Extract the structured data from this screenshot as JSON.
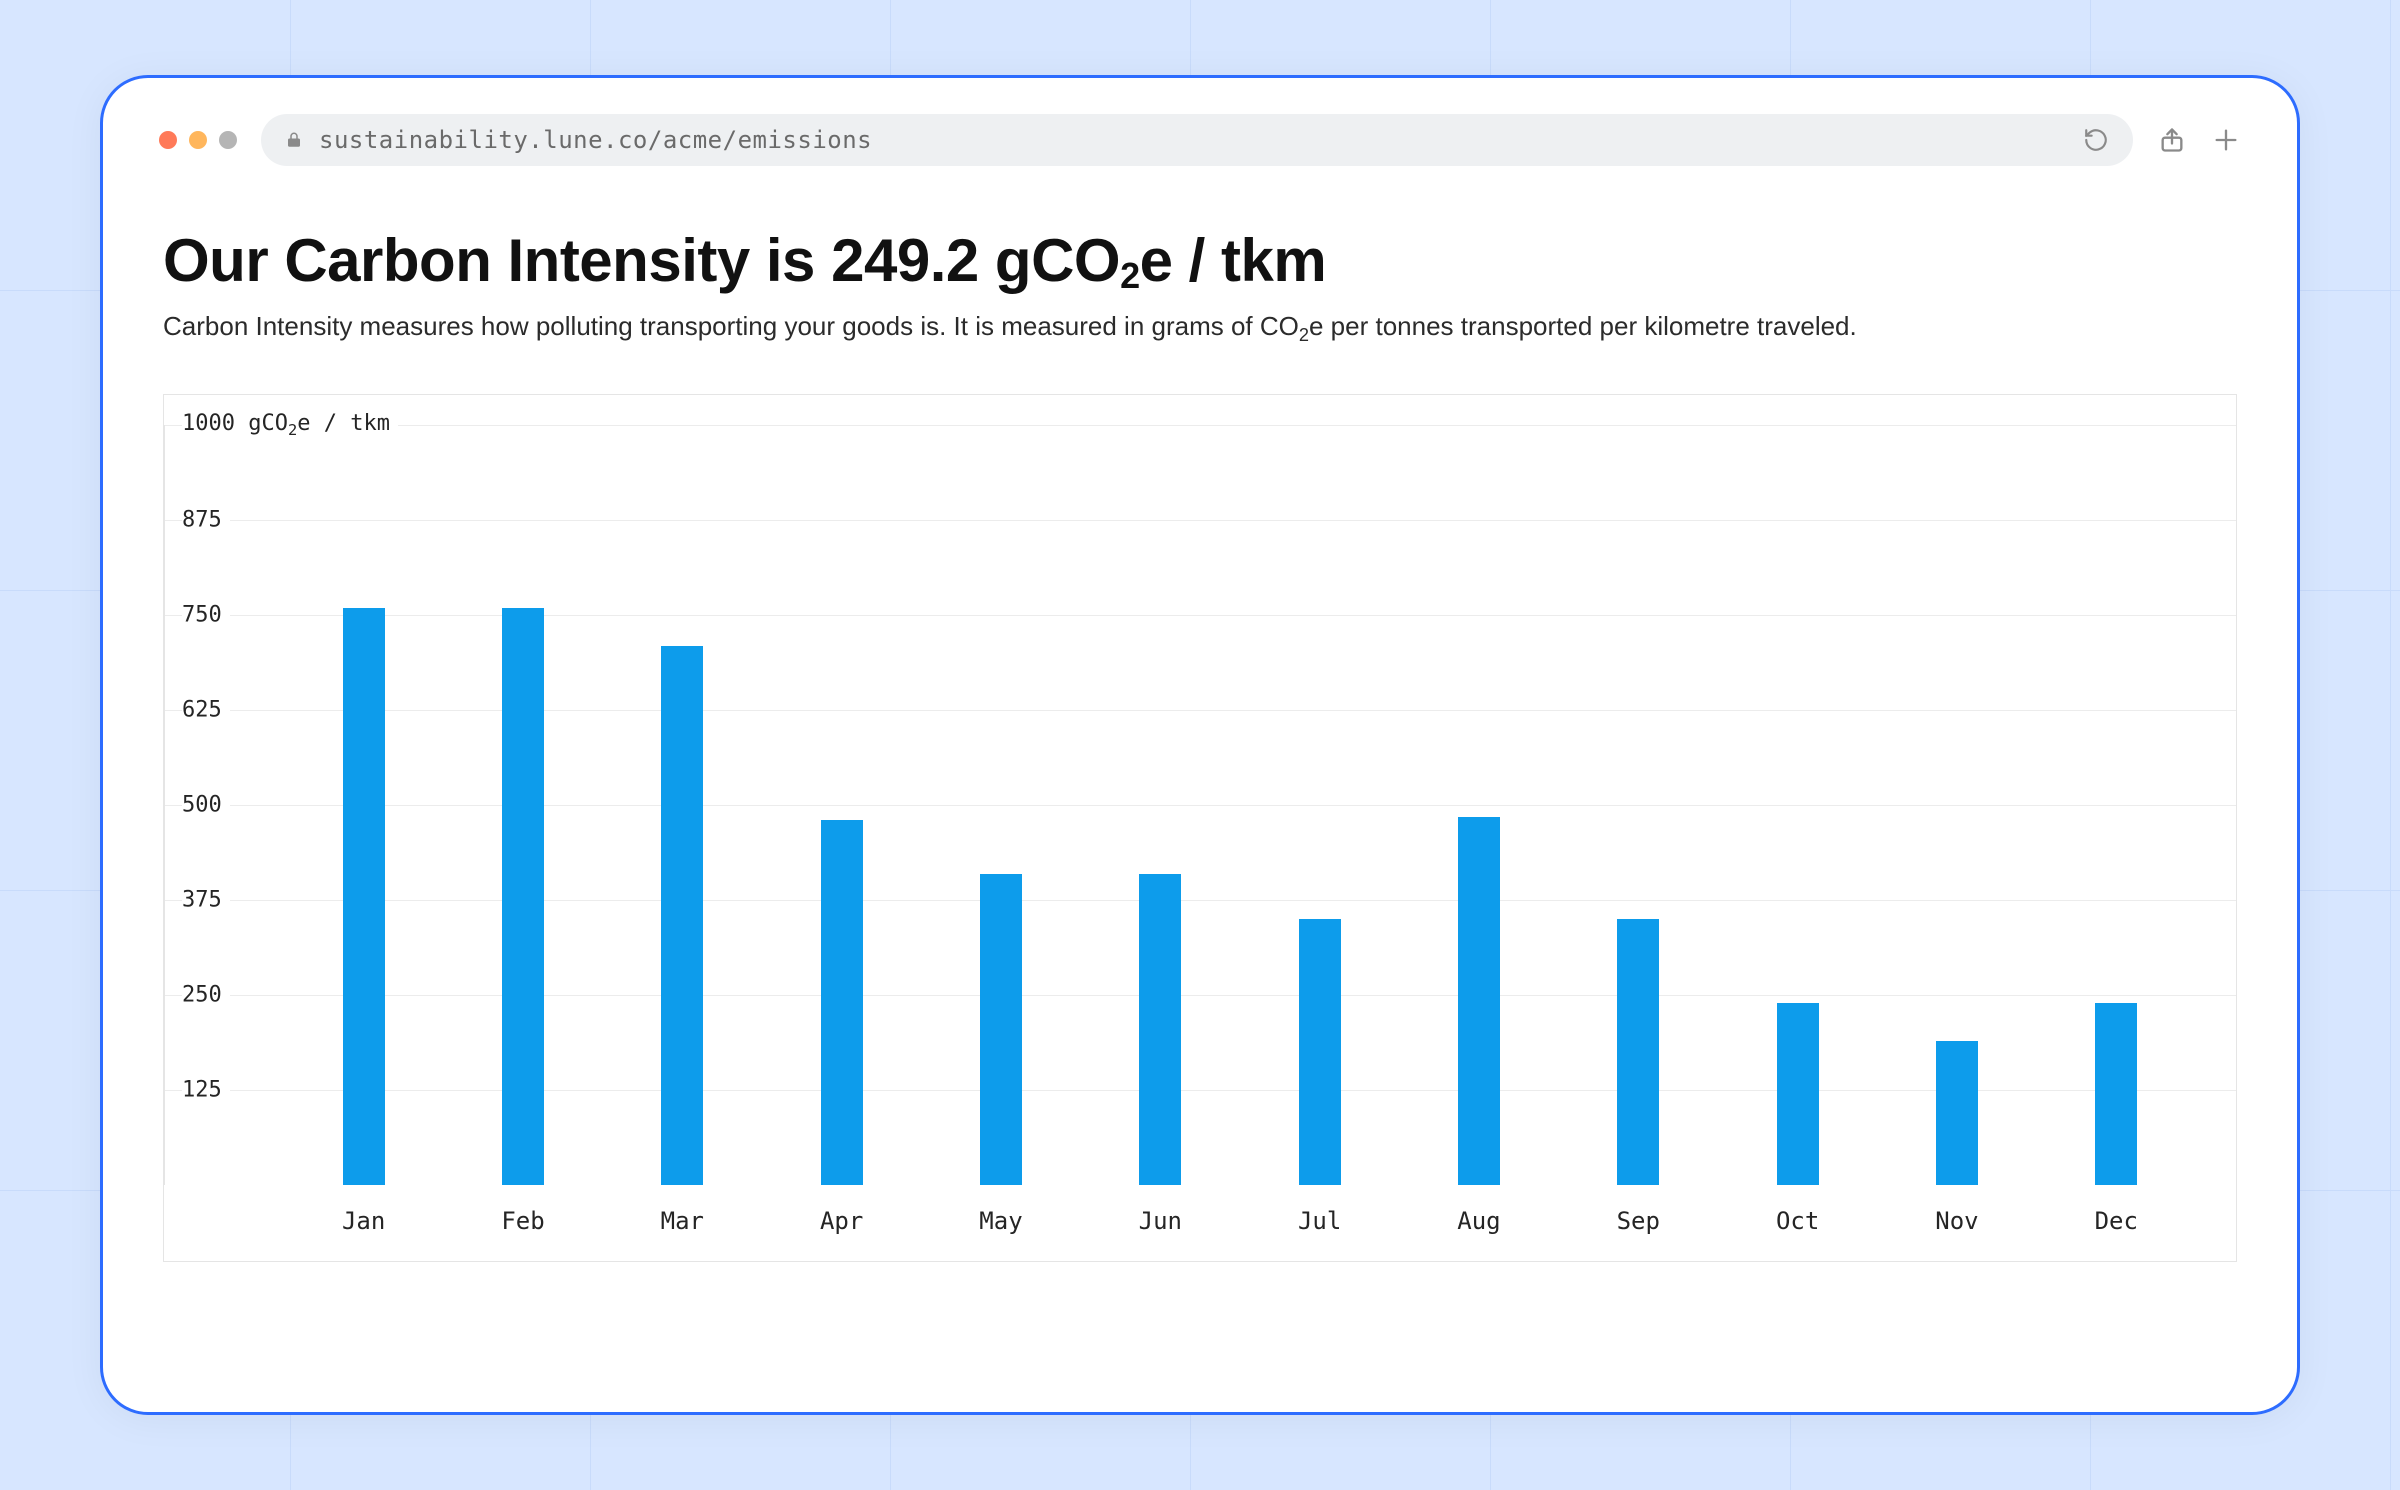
{
  "browser": {
    "url": "sustainability.lune.co/acme/emissions"
  },
  "header": {
    "title_html": "Our Carbon Intensity is 249.2 gCO<sub>2</sub>e / tkm",
    "subtitle_html": "Carbon Intensity measures how polluting transporting your goods is. It is measured in grams of CO<sub>2</sub>e per tonnes transported per kilometre traveled."
  },
  "chart_data": {
    "type": "bar",
    "categories": [
      "Jan",
      "Feb",
      "Mar",
      "Apr",
      "May",
      "Jun",
      "Jul",
      "Aug",
      "Sep",
      "Oct",
      "Nov",
      "Dec"
    ],
    "values": [
      760,
      760,
      710,
      480,
      410,
      410,
      350,
      485,
      350,
      240,
      190,
      240
    ],
    "ylabel": "gCO₂e / tkm",
    "y_top_label_html": "1000 gCO<sub>2</sub>e / tkm",
    "y_ticks": [
      125,
      250,
      375,
      500,
      625,
      750,
      875,
      1000
    ],
    "ylim": [
      0,
      1000
    ],
    "bar_color": "#0d9ceb"
  }
}
